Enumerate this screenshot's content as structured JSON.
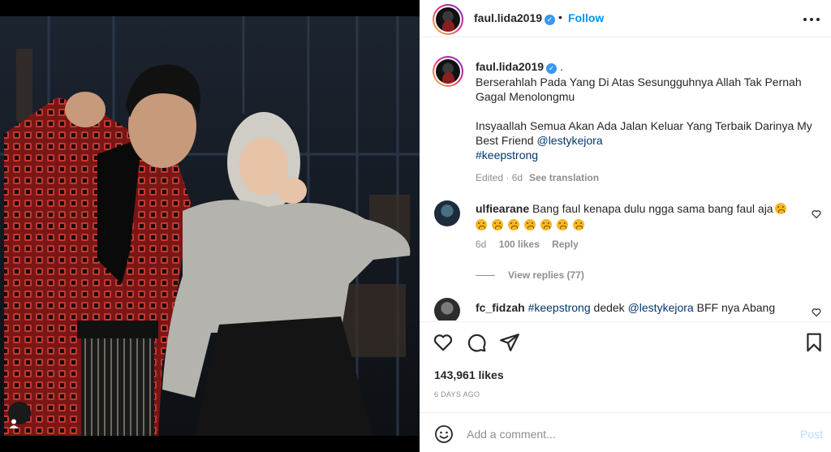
{
  "post": {
    "username": "faul.lida2019",
    "follow_label": "Follow",
    "separator": "•",
    "verified_glyph": "✓"
  },
  "caption": {
    "username": "faul.lida2019",
    "trailing": ".",
    "line1": "Berserahlah Pada Yang Di Atas Sesungguhnya Allah Tak Pernah Gagal Menolongmu",
    "line2": "Insyaallah Semua Akan Ada Jalan Keluar Yang Terbaik Darinya My Best Friend",
    "mention": "@lestykejora",
    "hashtag": "#keepstrong",
    "edited": "Edited · 6d",
    "see_translation": "See translation"
  },
  "comments": [
    {
      "username": "ulfiearane",
      "text": "Bang faul kenapa dulu ngga sama bang faul aja",
      "time": "6d",
      "likes": "100 likes",
      "reply": "Reply",
      "view_replies": "View replies (77)"
    },
    {
      "username": "fc_fidzah",
      "hashtag": "#keepstrong",
      "text1": "dedek",
      "mention": "@lestykejora",
      "text2": "BFF nya Abang"
    }
  ],
  "engagement": {
    "likes": "143,961 likes",
    "time_ago": "6 DAYS AGO"
  },
  "composer": {
    "placeholder": "Add a comment...",
    "post_label": "Post"
  },
  "colors": {
    "accent": "#0095f6",
    "verified": "#3897f0",
    "muted": "#8e8e8e",
    "post_disabled": "#b2dffc"
  },
  "icons": [
    "tag-user-icon",
    "more-options-icon",
    "heart-icon",
    "comment-icon",
    "share-icon",
    "bookmark-icon",
    "emoji-icon",
    "verified-badge-icon"
  ]
}
